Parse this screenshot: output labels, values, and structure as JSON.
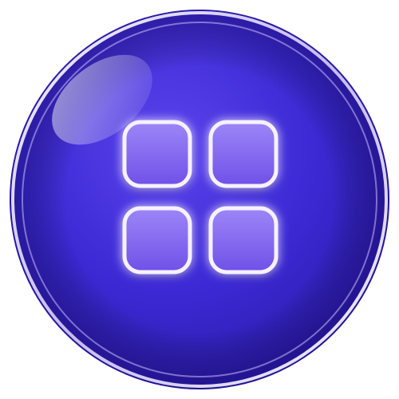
{
  "icon": {
    "name": "app-grid-icon",
    "tiles": 4
  },
  "colors": {
    "orb_dark": "#2e1fb8",
    "orb_mid": "#4a33e0",
    "orb_light": "#7a5cf2",
    "rim": "#efe6ff",
    "tile_fill": "#8a6ff2",
    "tile_stroke": "#f4efff",
    "glow": "#c8b8ff"
  }
}
